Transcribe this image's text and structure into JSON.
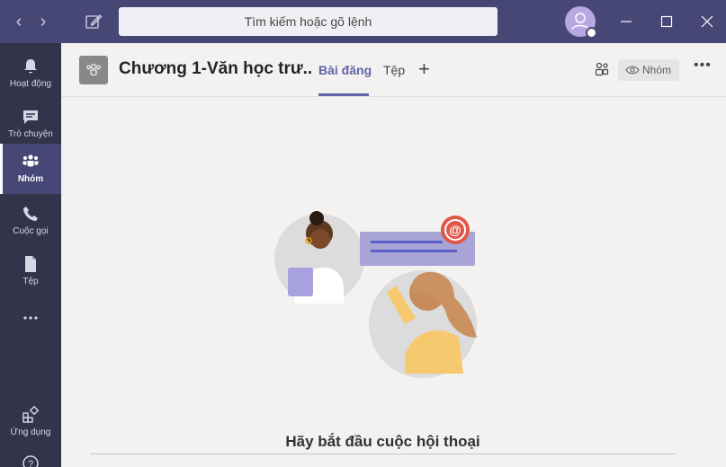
{
  "titlebar": {
    "search_placeholder": "Tìm kiếm hoặc gõ lệnh",
    "back_icon": "chevron-left-icon",
    "forward_icon": "chevron-right-icon",
    "compose_icon": "compose-icon",
    "window_controls": [
      "minimize-icon",
      "maximize-icon",
      "close-icon"
    ]
  },
  "rail": {
    "items": [
      {
        "label": "Hoạt động",
        "icon": "bell-icon"
      },
      {
        "label": "Trò chuyện",
        "icon": "chat-icon"
      },
      {
        "label": "Nhóm",
        "icon": "teams-icon",
        "active": true
      },
      {
        "label": "Cuộc gọi",
        "icon": "phone-icon"
      },
      {
        "label": "Tệp",
        "icon": "file-icon"
      },
      {
        "label": "",
        "icon": "more-icon"
      },
      {
        "label": "Ứng dụng",
        "icon": "apps-icon"
      },
      {
        "label": "",
        "icon": "help-icon"
      }
    ]
  },
  "header": {
    "channel_title": "Chương 1-Văn học trư...",
    "tabs": [
      {
        "label": "Bài đăng",
        "active": true
      },
      {
        "label": "Tệp"
      }
    ],
    "add_tab": "+",
    "team_button": "Nhóm",
    "more": "•••"
  },
  "content": {
    "empty_title": "Hãy bắt đầu cuộc hội thoại"
  },
  "colors": {
    "titlebar": "#464775",
    "rail": "#33344a",
    "accent": "#6264a7",
    "background": "#f3f2f1"
  }
}
